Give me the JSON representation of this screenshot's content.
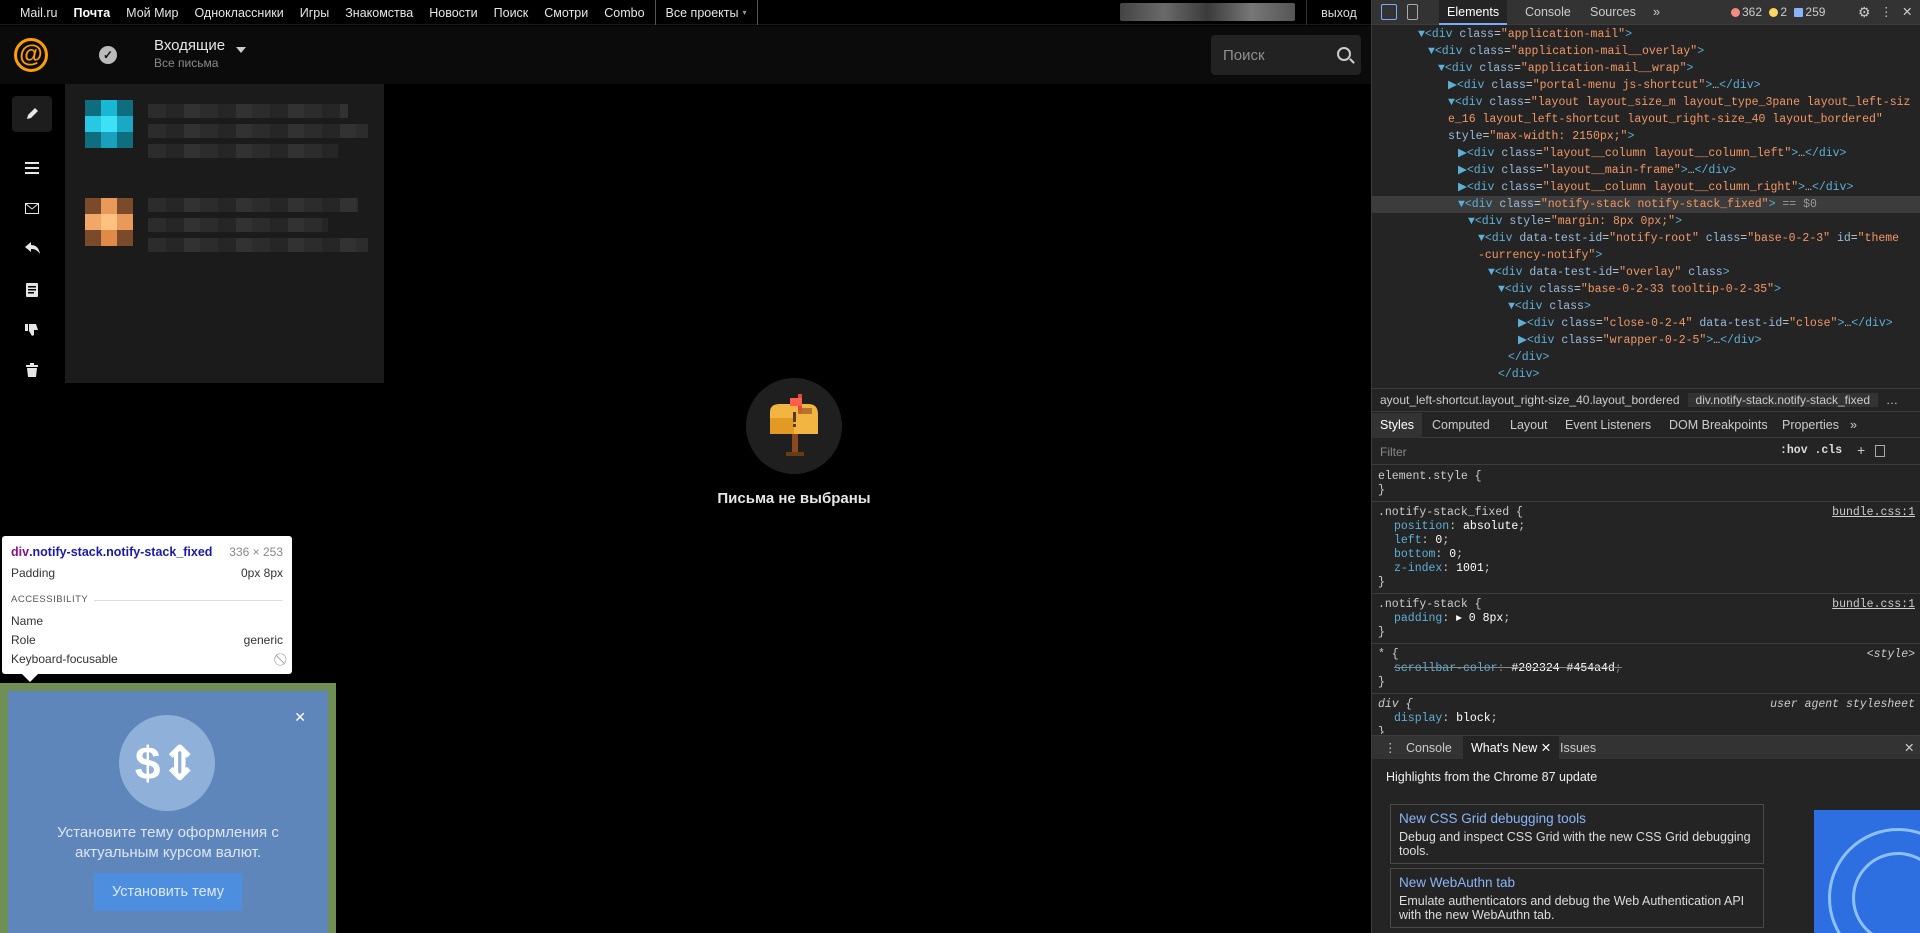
{
  "portal": {
    "nav": [
      "Mail.ru",
      "Почта",
      "Мой Мир",
      "Одноклассники",
      "Игры",
      "Знакомства",
      "Новости",
      "Поиск",
      "Смотри",
      "Combo"
    ],
    "all_projects": "Все проекты",
    "logout": "выход"
  },
  "mail_header": {
    "logo_glyph": "@",
    "folder_title": "Входящие",
    "folder_subtitle": "Все письма",
    "search_placeholder": "Поиск"
  },
  "toolbar_icons": [
    "pencil-icon",
    "menu-icon",
    "envelope-icon",
    "reply-icon",
    "document-icon",
    "thumbs-down-icon",
    "trash-icon"
  ],
  "empty_state": {
    "text": "Письма не выбраны"
  },
  "inspect_tooltip": {
    "selector_tag": "div",
    "selector_rest": ".notify-stack.notify-stack_fixed",
    "size": "336 × 253",
    "padding_label": "Padding",
    "padding_value": "0px 8px",
    "section": "ACCESSIBILITY",
    "name_label": "Name",
    "role_label": "Role",
    "role_value": "generic",
    "keyboard_label": "Keyboard-focusable"
  },
  "theme_notify": {
    "message": "Установите тему оформления с актуальным курсом валют.",
    "button": "Установить тему",
    "colors": {
      "panel": "#5e86ba",
      "button": "#4d8ede",
      "border": "#6f8f55"
    }
  },
  "devtools": {
    "tabs": [
      "Elements",
      "Console",
      "Sources"
    ],
    "more": "»",
    "errors": "362",
    "warnings": "2",
    "messages": "259",
    "dom_lines": [
      {
        "indent": 4,
        "html": "<span class='tg'>▼&lt;div</span> <span class='at'>class</span>=<span class='av'>\"application-mail\"</span><span class='tg'>&gt;</span>"
      },
      {
        "indent": 5,
        "html": "<span class='tg'>▼&lt;div</span> <span class='at'>class</span>=<span class='av'>\"application-mail__overlay\"</span><span class='tg'>&gt;</span>"
      },
      {
        "indent": 6,
        "html": "<span class='tg'>▼&lt;div</span> <span class='at'>class</span>=<span class='av'>\"application-mail__wrap\"</span><span class='tg'>&gt;</span>"
      },
      {
        "indent": 7,
        "html": "<span class='tg'>▶&lt;div</span> <span class='at'>class</span>=<span class='av'>\"portal-menu js-shortcut\"</span><span class='tg'>&gt;</span>…<span class='tg'>&lt;/div&gt;</span>"
      },
      {
        "indent": 7,
        "html": "<span class='tg'>▼&lt;div</span> <span class='at'>class</span>=<span class='av'>\"layout layout_size_m layout_type_3pane layout_left-siz</span>"
      },
      {
        "indent": 7,
        "html": "<span class='av'>e_16 layout_left-shortcut layout_right-size_40 layout_bordered\"</span>"
      },
      {
        "indent": 7,
        "html": "<span class='at'>style</span>=<span class='av'>\"max-width: 2150px;\"</span><span class='tg'>&gt;</span>"
      },
      {
        "indent": 8,
        "html": "<span class='tg'>▶&lt;div</span> <span class='at'>class</span>=<span class='av'>\"layout__column layout__column_left\"</span><span class='tg'>&gt;</span>…<span class='tg'>&lt;/div&gt;</span>"
      },
      {
        "indent": 8,
        "html": "<span class='tg'>▶&lt;div</span> <span class='at'>class</span>=<span class='av'>\"layout__main-frame\"</span><span class='tg'>&gt;</span>…<span class='tg'>&lt;/div&gt;</span>"
      },
      {
        "indent": 8,
        "html": "<span class='tg'>▶&lt;div</span> <span class='at'>class</span>=<span class='av'>\"layout__column layout__column_right\"</span><span class='tg'>&gt;</span>…<span class='tg'>&lt;/div&gt;</span>"
      },
      {
        "indent": 8,
        "sel": true,
        "html": "<span class='tg'>▼&lt;div</span> <span class='at'>class</span>=<span class='av'>\"notify-stack notify-stack_fixed\"</span><span class='tg'>&gt;</span> <span class='mu'>== $0</span>"
      },
      {
        "indent": 9,
        "html": "<span class='tg'>▼&lt;div</span> <span class='at'>style</span>=<span class='av'>\"margin: 8px 0px;\"</span><span class='tg'>&gt;</span>"
      },
      {
        "indent": 10,
        "html": "<span class='tg'>▼&lt;div</span> <span class='at'>data-test-id</span>=<span class='av'>\"notify-root\"</span> <span class='at'>class</span>=<span class='av'>\"base-0-2-3\"</span> <span class='at'>id</span>=<span class='av'>\"theme</span>"
      },
      {
        "indent": 10,
        "html": "<span class='av'>-currency-notify\"</span><span class='tg'>&gt;</span>"
      },
      {
        "indent": 11,
        "html": "<span class='tg'>▼&lt;div</span> <span class='at'>data-test-id</span>=<span class='av'>\"overlay\"</span> <span class='at'>class</span><span class='tg'>&gt;</span>"
      },
      {
        "indent": 12,
        "html": "<span class='tg'>▼&lt;div</span> <span class='at'>class</span>=<span class='av'>\"base-0-2-33 tooltip-0-2-35\"</span><span class='tg'>&gt;</span>"
      },
      {
        "indent": 13,
        "html": "<span class='tg'>▼&lt;div</span> <span class='at'>class</span><span class='tg'>&gt;</span>"
      },
      {
        "indent": 14,
        "html": "<span class='tg'>▶&lt;div</span> <span class='at'>class</span>=<span class='av'>\"close-0-2-4\"</span> <span class='at'>data-test-id</span>=<span class='av'>\"close\"</span><span class='tg'>&gt;</span>…<span class='tg'>&lt;/div&gt;</span>"
      },
      {
        "indent": 14,
        "html": "<span class='tg'>▶&lt;div</span> <span class='at'>class</span>=<span class='av'>\"wrapper-0-2-5\"</span><span class='tg'>&gt;</span>…<span class='tg'>&lt;/div&gt;</span>"
      },
      {
        "indent": 13,
        "html": "<span class='tg'>&lt;/div&gt;</span>"
      },
      {
        "indent": 12,
        "html": "<span class='tg'>&lt;/div&gt;</span>"
      }
    ],
    "breadcrumb_prev": "ayout_left-shortcut.layout_right-size_40.layout_bordered",
    "breadcrumb_current": "div.notify-stack.notify-stack_fixed",
    "style_tabs": [
      "Styles",
      "Computed",
      "Layout",
      "Event Listeners",
      "DOM Breakpoints",
      "Properties"
    ],
    "filter_placeholder": "Filter",
    "hov_cls": ":hov .cls",
    "rules": [
      {
        "selector": "element.style {",
        "source": "",
        "props": []
      },
      {
        "selector": ".notify-stack_fixed {",
        "source": "bundle.css:1",
        "props": [
          [
            "position",
            "absolute"
          ],
          [
            "left",
            "0"
          ],
          [
            "bottom",
            "0"
          ],
          [
            "z-index",
            "1001"
          ]
        ]
      },
      {
        "selector": ".notify-stack {",
        "source": "bundle.css:1",
        "props": [
          [
            "padding",
            "▸ 0 8px"
          ]
        ]
      },
      {
        "selector": "* {",
        "source": "<style>",
        "props": [
          [
            "scrollbar-color",
            "#202324 #454a4d",
            "strike"
          ]
        ]
      },
      {
        "selector": "div {",
        "source": "user agent stylesheet",
        "props": [
          [
            "display",
            "block"
          ]
        ]
      }
    ],
    "drawer_tabs": [
      "Console",
      "What's New",
      "Issues"
    ],
    "highlights": "Highlights from the Chrome 87 update",
    "cards": [
      {
        "title": "New CSS Grid debugging tools",
        "desc": "Debug and inspect CSS Grid with the new CSS Grid debugging tools."
      },
      {
        "title": "New WebAuthn tab",
        "desc": "Emulate authenticators and debug the Web Authentication API with the new WebAuthn tab."
      }
    ]
  }
}
